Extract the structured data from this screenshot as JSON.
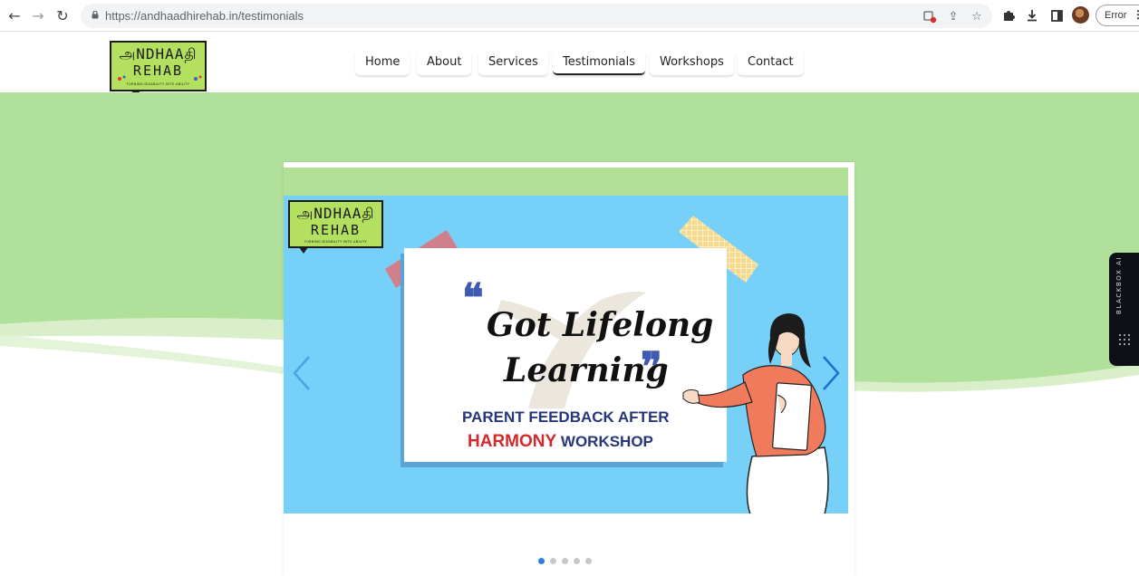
{
  "browser": {
    "url": "https://andhaadhirehab.in/testimonials",
    "error_label": "Error"
  },
  "logo": {
    "line1": "அNDHAAதி",
    "line2": "REHAB",
    "tagline": "TURNING DISABILITY INTO ABILITY"
  },
  "nav": {
    "items": [
      {
        "label": "Home"
      },
      {
        "label": "About"
      },
      {
        "label": "Services"
      },
      {
        "label": "Testimonials"
      },
      {
        "label": "Workshops"
      },
      {
        "label": "Contact"
      }
    ],
    "active": "Testimonials"
  },
  "slide": {
    "headline_line1": "Got Lifelong",
    "headline_line2": "Learning",
    "quote_open": "❝",
    "quote_close": "❞",
    "subtitle_line1": "PARENT FEEDBACK  AFTER",
    "subtitle_highlight": "HARMONY",
    "subtitle_rest": " WORKSHOP"
  },
  "carousel": {
    "slide_count": 5,
    "active_index": 0
  },
  "sidebar_extension": {
    "label": "BLACKBOX AI"
  },
  "colors": {
    "hero_green": "#b0e09a",
    "slide_blue": "#77d0f7",
    "logo_green": "#b3e05e",
    "accent_red": "#d22a2a",
    "accent_navy": "#27357a",
    "dot_active": "#2e7fd8"
  }
}
